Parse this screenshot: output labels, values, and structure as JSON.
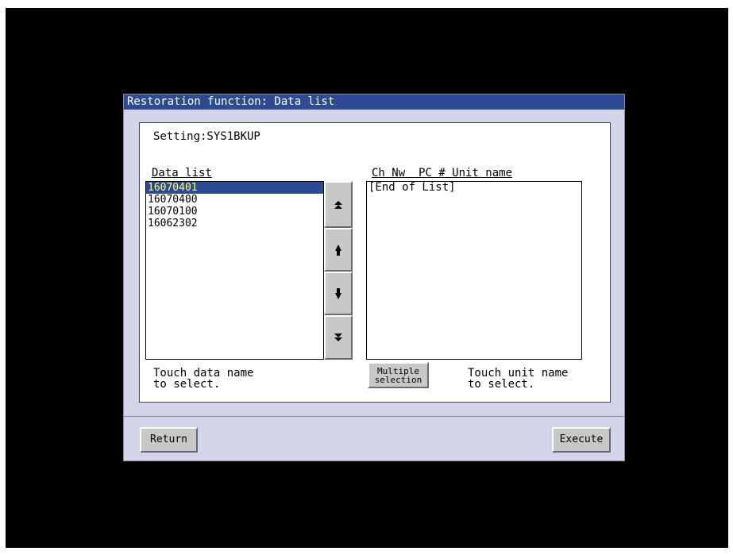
{
  "window": {
    "title": "Restoration function: Data list"
  },
  "panel": {
    "setting": "Setting:SYS1BKUP",
    "data_list_label": "Data list",
    "unit_columns_label": "Ch Nw  PC # Unit name",
    "data_items": [
      "16070401",
      "16070400",
      "16070100",
      "16062302"
    ],
    "selected_index": 0,
    "unit_items": [
      "[End of List]"
    ],
    "hint_data": "Touch data name\nto select.",
    "hint_unit": "Touch unit name\nto select.",
    "multiple_selection_label": "Multiple\nselection"
  },
  "scroll": {
    "page_up_icon": "double-up-arrow-icon",
    "up_icon": "up-arrow-icon",
    "down_icon": "down-arrow-icon",
    "page_down_icon": "double-down-arrow-icon"
  },
  "footer": {
    "return_label": "Return",
    "execute_label": "Execute"
  },
  "colors": {
    "title_bar": "#2d4b93",
    "window_bg": "#d2d4ea",
    "selected_text": "#ffff66"
  }
}
